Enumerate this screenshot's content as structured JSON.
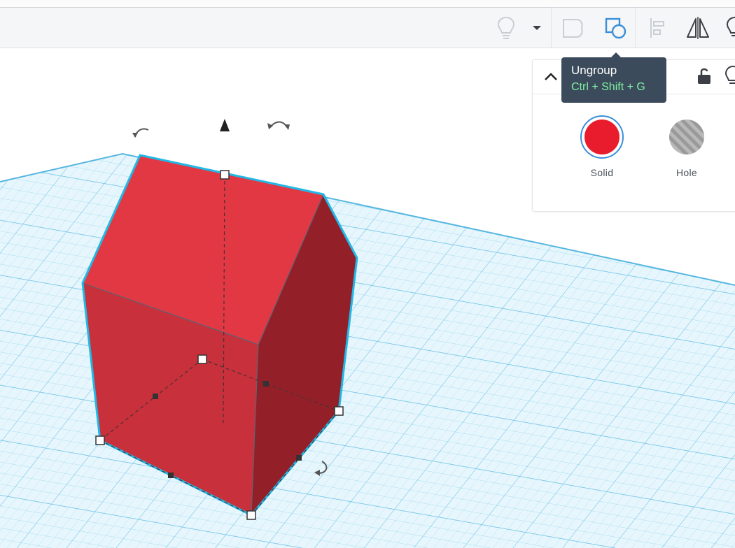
{
  "toolbar": {
    "buttons": [
      {
        "name": "show-hint-lightbulb",
        "icon": "lightbulb-icon"
      },
      {
        "name": "hint-dropdown",
        "icon": "caret-down-icon"
      },
      {
        "name": "group",
        "icon": "group-icon"
      },
      {
        "name": "ungroup",
        "icon": "ungroup-icon",
        "active": true
      },
      {
        "name": "align",
        "icon": "align-icon"
      },
      {
        "name": "mirror",
        "icon": "mirror-icon"
      },
      {
        "name": "lightbulb-2",
        "icon": "lightbulb-icon"
      }
    ]
  },
  "tooltip": {
    "title": "Ungroup",
    "shortcut": "Ctrl + Shift + G"
  },
  "inspector": {
    "collapse_icon": "chevron-up-icon",
    "lock_icon": "lock-open-icon",
    "light_icon": "lightbulb-icon",
    "solid_label": "Solid",
    "hole_label": "Hole",
    "solid_color": "#e81c2c",
    "selected": "Solid"
  },
  "colors": {
    "shape_front": "#c8303b",
    "shape_top": "#e23844",
    "shape_side": "#932029",
    "selection_outline": "#22b8e6",
    "grid": "#8fd3ef",
    "accent_blue": "#3b8fd9"
  }
}
